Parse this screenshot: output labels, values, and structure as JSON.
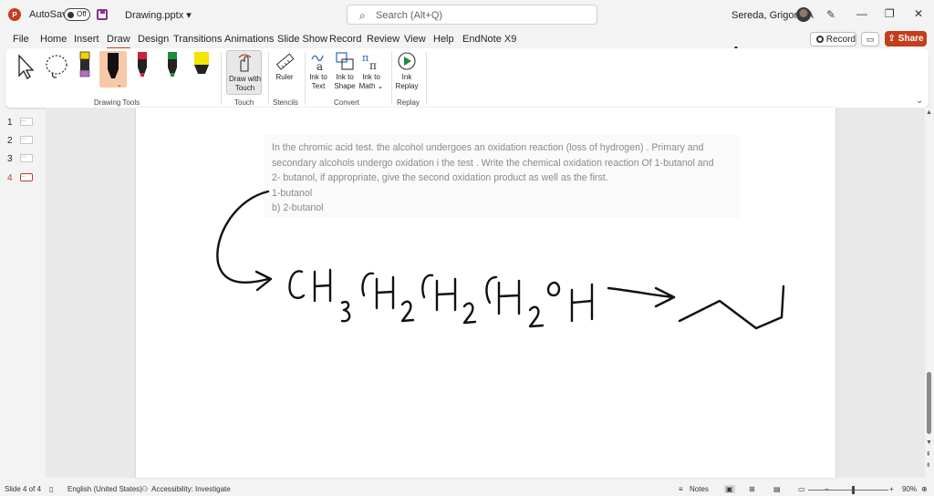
{
  "titlebar": {
    "autosave_label": "AutoSave",
    "autosave_state": "Off",
    "filename": "Drawing.pptx",
    "search_placeholder": "Search (Alt+Q)",
    "user_name": "Sereda, Grigoriy A",
    "minimize": "—",
    "restore": "❐",
    "close": "✕"
  },
  "tabs": [
    {
      "label": "File"
    },
    {
      "label": "Home"
    },
    {
      "label": "Insert"
    },
    {
      "label": "Draw",
      "active": true
    },
    {
      "label": "Design"
    },
    {
      "label": "Transitions"
    },
    {
      "label": "Animations"
    },
    {
      "label": "Slide Show"
    },
    {
      "label": "Record"
    },
    {
      "label": "Review"
    },
    {
      "label": "View"
    },
    {
      "label": "Help"
    },
    {
      "label": "EndNote X9"
    }
  ],
  "actions": {
    "record": "Record",
    "share": "Share"
  },
  "ribbon": {
    "groups": {
      "drawing_tools": "Drawing Tools",
      "touch": "Touch",
      "stencils": "Stencils",
      "convert": "Convert",
      "replay": "Replay"
    },
    "buttons": {
      "draw_with_touch_1": "Draw with",
      "draw_with_touch_2": "Touch",
      "ruler": "Ruler",
      "ink_to_text_1": "Ink to",
      "ink_to_text_2": "Text",
      "ink_to_shape_1": "Ink to",
      "ink_to_shape_2": "Shape",
      "ink_to_math_1": "Ink to",
      "ink_to_math_2": "Math ⌄",
      "ink_replay_1": "Ink",
      "ink_replay_2": "Replay"
    },
    "pen_colors": [
      "#f5d300",
      "#111111",
      "#d21f3c",
      "#1a8f3a",
      "#f2e600"
    ]
  },
  "thumbs": [
    {
      "num": "1",
      "preview": "—"
    },
    {
      "num": "2",
      "preview": "~~"
    },
    {
      "num": "3",
      "preview": "~~"
    },
    {
      "num": "4",
      "preview": "—",
      "active": true
    }
  ],
  "slide": {
    "question_line1": "In the chromic acid test. the alcohol undergoes an oxidation reaction (loss of hydrogen) . Primary and",
    "question_line2": "secondary alcohols undergo oxidation i the test . Write the chemical oxidation reaction Of 1-butanol and",
    "question_line3": "2- butanol, if appropriate, give the second oxidation product as well as the first.",
    "question_line4": "1-butanol",
    "question_line5": "b) 2-butanol"
  },
  "statusbar": {
    "slide_of": "Slide 4 of 4",
    "language": "English (United States)",
    "accessibility": "Accessibility: Investigate",
    "notes": "Notes",
    "zoom": "90%"
  }
}
